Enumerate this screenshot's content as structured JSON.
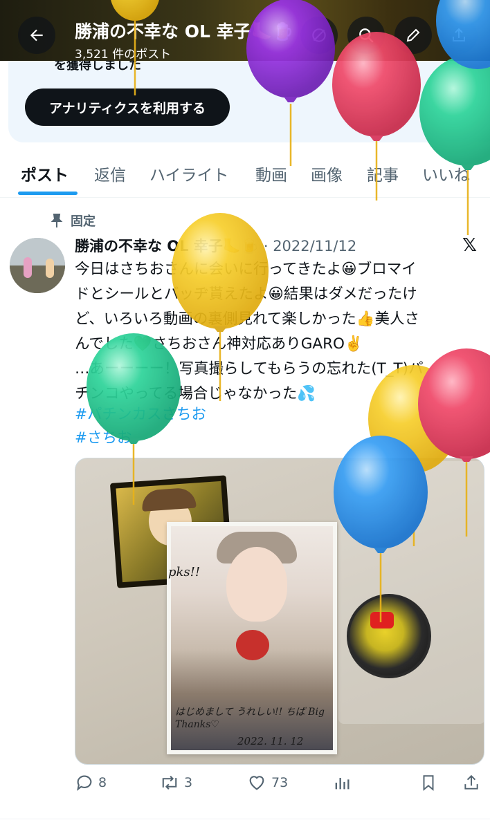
{
  "header": {
    "title": "勝浦の不幸な OL 幸子🦶🍺",
    "post_count": "3,521 件のポスト"
  },
  "profile_card": {
    "text": "を獲得しました",
    "analytics_button": "アナリティクスを利用する"
  },
  "tabs": [
    {
      "label": "ポスト",
      "active": true
    },
    {
      "label": "返信",
      "active": false
    },
    {
      "label": "ハイライト",
      "active": false
    },
    {
      "label": "動画",
      "active": false
    },
    {
      "label": "画像",
      "active": false
    },
    {
      "label": "記事",
      "active": false
    },
    {
      "label": "いいね",
      "active": false
    }
  ],
  "post": {
    "pinned_label": "固定",
    "author_name": "勝浦の不幸な OL 幸子🦶🍺",
    "date": "· 2022/11/12",
    "body_lines": [
      "今日はさちおさんに会いに行ってきたよ😀ブロマイ",
      "ドとシールとバッヂ貰えたよ😀結果はダメだったけ",
      "ど、いろいろ動画の裏側見れて楽しかった👍美人さ",
      "んでした💚さちおさん神対応ありGARO✌️",
      "…あーーーー！写真撮らしてもらうの忘れた(T_T)パ",
      "チンコやってる場合じゃなかった💦"
    ],
    "hashtags": [
      "#パチンカスさちお",
      "#さちお"
    ],
    "media": {
      "signature_top": "pks!!",
      "signature_bottom": "はじめまして うれしい!! ちば Big Thanks♡",
      "signature_date": "2022. 11. 12"
    },
    "actions": {
      "replies": "8",
      "reposts": "3",
      "likes": "73"
    }
  },
  "colors": {
    "accent": "#1d9bf0",
    "text_primary": "#0f1419",
    "text_secondary": "#536471",
    "balloon_yellow": "#f7cf2e",
    "balloon_purple": "#9b35e6",
    "balloon_red": "#f04a6a",
    "balloon_green": "#2fd49a",
    "balloon_blue": "#3aa0f5"
  },
  "icons": {
    "back": "arrow-left-icon",
    "search": "search-icon",
    "edit": "pencil-icon",
    "share": "share-icon",
    "pin": "pin-icon",
    "x_logo": "x-logo-icon",
    "reply": "reply-icon",
    "repost": "repost-icon",
    "like": "heart-icon",
    "views": "analytics-icon",
    "bookmark": "bookmark-icon"
  }
}
